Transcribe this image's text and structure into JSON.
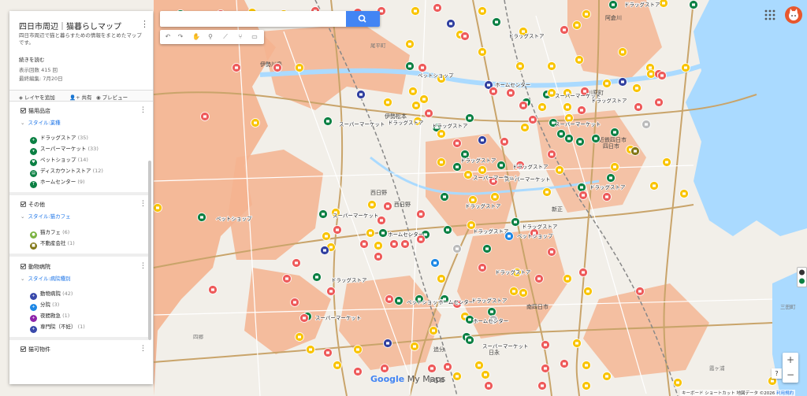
{
  "panel": {
    "title": "四日市周辺｜猫暮らしマップ",
    "description": "四日市周辺で猫と暮らすための情報をまとめたマップです。",
    "read_more": "続きを読む",
    "views": "表示回数 415 回",
    "last_edit": "最終編集: 7月20日",
    "actions": {
      "add_layer": "レイヤを追加",
      "share": "共有",
      "preview": "プレビュー"
    },
    "layers": [
      {
        "name": "猫用品店",
        "style": "スタイル:業種",
        "items": [
          {
            "label": "ドラッグストア",
            "count": "(35)",
            "color": "#0b8043"
          },
          {
            "label": "スーパーマーケット",
            "count": "(33)",
            "color": "#0b8043"
          },
          {
            "label": "ペットショップ",
            "count": "(14)",
            "color": "#0b8043"
          },
          {
            "label": "ディスカウントストア",
            "count": "(12)",
            "color": "#0b8043"
          },
          {
            "label": "ホームセンター",
            "count": "(9)",
            "color": "#0b8043"
          }
        ]
      },
      {
        "name": "その他",
        "style": "スタイル:猫カフェ",
        "items": [
          {
            "label": "猫カフェ",
            "count": "(6)",
            "color": "#7cb342"
          },
          {
            "label": "不動産会社",
            "count": "(1)",
            "color": "#827717"
          }
        ]
      },
      {
        "name": "動物病院",
        "style": "スタイル:病院種別",
        "items": [
          {
            "label": "動物病院",
            "count": "(42)",
            "color": "#3949ab"
          },
          {
            "label": "分院",
            "count": "(3)",
            "color": "#1e88e5"
          },
          {
            "label": "夜間救急",
            "count": "(1)",
            "color": "#8e24aa"
          },
          {
            "label": "専門院（不妊）",
            "count": "(1)",
            "color": "#3949ab"
          }
        ]
      },
      {
        "name": "猫可物件",
        "style": "",
        "items": []
      }
    ]
  },
  "search": {
    "placeholder": ""
  },
  "map_labels": {
    "stations": [
      "伊勢川島",
      "伊勢松本",
      "西日野",
      "西日野",
      "四日市",
      "新正",
      "南四日市",
      "追分",
      "小古曽",
      "阿倉川",
      "川原町",
      "近鉄四日市",
      "日永"
    ],
    "places": [
      "尾平町",
      "三田町",
      "四郷",
      "霞ヶ浦"
    ],
    "pins": [
      "ドラッグストア",
      "ペットショップ",
      "ホームセンター",
      "スーパーマーケット",
      "ドラッグストア",
      "ドラッグストア",
      "ドラッグストア",
      "ドラッグストア",
      "スーパーマーケット",
      "スーパーマーケット",
      "ドラッグストア",
      "スーパーマーケット",
      "スーパーマーケット",
      "ペットショップ",
      "ホームセンター",
      "ドラッグストア",
      "ペットショップ",
      "スーパーマーケット",
      "ドラッグストア",
      "ドラッグストア",
      "ドラッグストア",
      "ペットショップ",
      "ホームセンター",
      "スーパーマーケット",
      "スーパーマーケット",
      "ホームセンター",
      "ドラッグストア",
      "ドラッグストア",
      "ドラッグストア",
      "ドラッグストア"
    ]
  },
  "logo": {
    "google": "Google",
    "mymaps": "My Maps"
  },
  "attribution": {
    "shortcuts": "キーボード ショートカット",
    "mapdata": "地図データ ©2026",
    "terms": "利用規約"
  },
  "colors": {
    "primary": "#4285f4",
    "red_pin": "#ee5a5a",
    "yellow_pin": "#f9c400",
    "green_pin": "#0b8043",
    "navy_pin": "#303f9f",
    "land": "#f2efe9",
    "orange_zone": "#f4b38f",
    "water": "#aadaff"
  }
}
